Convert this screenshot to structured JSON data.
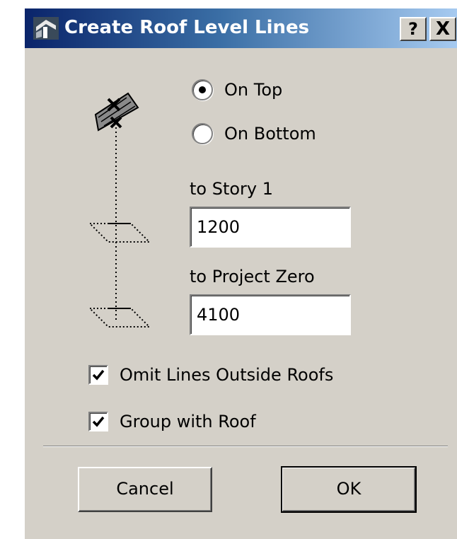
{
  "window": {
    "title": "Create Roof Level Lines",
    "help_label": "?",
    "close_label": "X"
  },
  "position": {
    "options": [
      {
        "label": "On Top",
        "selected": true
      },
      {
        "label": "On Bottom",
        "selected": false
      }
    ]
  },
  "levels": {
    "story_label": "to Story 1",
    "story_value": "1200",
    "zero_label": "to Project Zero",
    "zero_value": "4100"
  },
  "options": {
    "omit_label": "Omit Lines Outside Roofs",
    "omit_checked": true,
    "group_label": "Group with Roof",
    "group_checked": true
  },
  "buttons": {
    "cancel": "Cancel",
    "ok": "OK"
  },
  "colors": {
    "dialog_bg": "#d4d0c8",
    "title_gradient_start": "#0a246a",
    "title_gradient_end": "#a6caf0"
  }
}
